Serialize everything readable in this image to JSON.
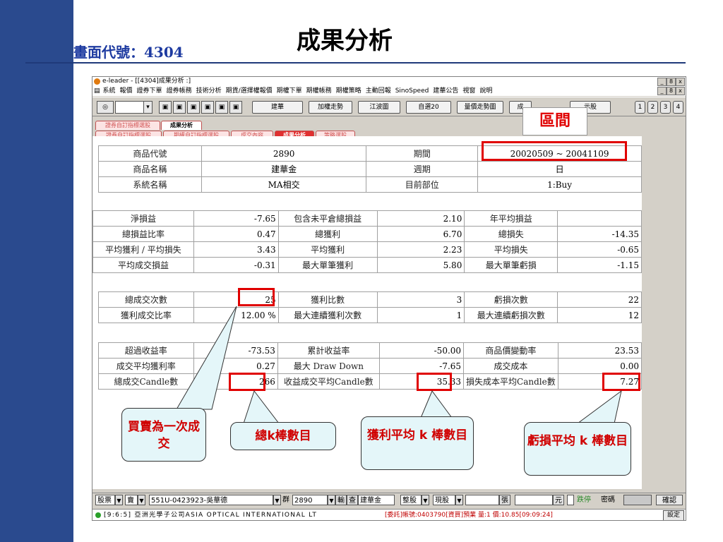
{
  "slide": {
    "screen_code": "畫面代號：4304",
    "title": "成果分析"
  },
  "window": {
    "title": "e-leader - [[4304]成果分析 :]",
    "controls": [
      "_",
      "8",
      "x"
    ],
    "menu": [
      "系統",
      "報價",
      "證券下單",
      "證券帳務",
      "技術分析",
      "期貨/選擇權報價",
      "期權下單",
      "期權帳務",
      "期權策略",
      "主動回報",
      "SinoSpeed",
      "建華公告",
      "視窗",
      "說明"
    ],
    "toolbar_buttons": [
      "建華",
      "加權走勢",
      "江波圖",
      "自選20",
      "量價走勢圖",
      "成",
      "示股"
    ],
    "toolbar_pages": [
      "1",
      "2",
      "3",
      "4"
    ],
    "tabs_row1": [
      "證券自訂指標選股",
      "成果分析"
    ],
    "tabs_row2": [
      "證券自訂指標選股",
      "期權自訂指標選股",
      "成交內容",
      "成果分析",
      "策略選股"
    ]
  },
  "annotation_zone": "區間",
  "info": {
    "rows": [
      [
        "商品代號",
        "2890",
        "期間",
        "20020509 ~ 20041109"
      ],
      [
        "商品名稱",
        "建華金",
        "週期",
        "日"
      ],
      [
        "系統名稱",
        "MA相交",
        "目前部位",
        "1:Buy"
      ]
    ]
  },
  "pnl": {
    "rows": [
      [
        "淨損益",
        "-7.65",
        "包含未平倉總損益",
        "2.10",
        "年平均損益",
        ""
      ],
      [
        "總損益比率",
        "0.47",
        "總獲利",
        "6.70",
        "總損失",
        "-14.35"
      ],
      [
        "平均獲利 / 平均損失",
        "3.43",
        "平均獲利",
        "2.23",
        "平均損失",
        "-0.65"
      ],
      [
        "平均成交損益",
        "-0.31",
        "最大單筆獲利",
        "5.80",
        "最大單筆虧損",
        "-1.15"
      ]
    ]
  },
  "trades": {
    "rows": [
      [
        "總成交次數",
        "25",
        "獲利比數",
        "3",
        "虧損次數",
        "22"
      ],
      [
        "獲利成交比率",
        "12.00 %",
        "最大連續獲利次數",
        "1",
        "最大連續虧損次數",
        "12"
      ]
    ]
  },
  "returns": {
    "rows": [
      [
        "超過收益率",
        "-73.53",
        "累計收益率",
        "-50.00",
        "商品價變動率",
        "23.53"
      ],
      [
        "成交平均獲利率",
        "0.27",
        "最大 Draw Down",
        "-7.65",
        "成交成本",
        "0.00"
      ],
      [
        "總成交Candle數",
        "266",
        "收益成交平均Candle數",
        "35.33",
        "損失成本平均Candle數",
        "7.27"
      ]
    ]
  },
  "callouts": {
    "one_trade": "買賣為一次成交",
    "total_k": "總k棒數目",
    "profit_avg_k": "獲利平均 k 棒數目",
    "loss_avg_k": "虧損平均 k 棒數目"
  },
  "order_bar": {
    "type": "股票",
    "side": "賣",
    "account": "551U-0423923-吳華德",
    "group": "群",
    "symbol": "2890",
    "input_btn": "輸",
    "query_btn": "查",
    "name": "建華金",
    "lot": "整股",
    "cash": "現股",
    "unit": "張",
    "currency": "元",
    "limit_down": "跌停",
    "password": "密碼",
    "confirm": "確認"
  },
  "status": {
    "time": "[9:6:5] 亞洲光學子公司ASIA OPTICAL INTERNATIONAL LT",
    "message": "[委託]帳號:0403790[資買]預業 量:1 價:10.85[09:09:24]",
    "settings": "設定"
  }
}
